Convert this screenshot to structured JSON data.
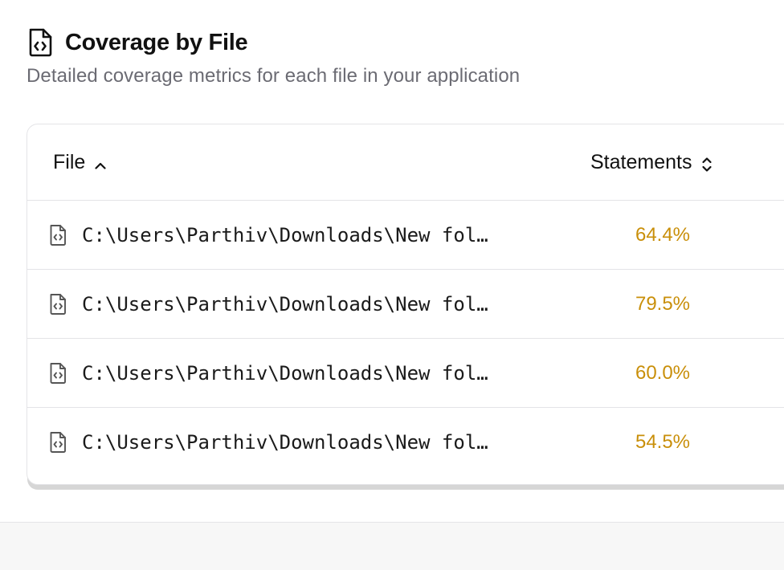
{
  "header": {
    "icon": "file-code-icon",
    "title": "Coverage by File",
    "subtitle": "Detailed coverage metrics for each file in your application"
  },
  "table": {
    "columns": {
      "file": {
        "label": "File",
        "sort_icon": "chevron-up-icon"
      },
      "statements": {
        "label": "Statements",
        "sort_icon": "chevrons-up-down-icon"
      }
    },
    "rows": [
      {
        "icon": "file-code-icon",
        "path": "C:\\Users\\Parthiv\\Downloads\\New fol…",
        "statements": "64.4%"
      },
      {
        "icon": "file-code-icon",
        "path": "C:\\Users\\Parthiv\\Downloads\\New fol…",
        "statements": "79.5%"
      },
      {
        "icon": "file-code-icon",
        "path": "C:\\Users\\Parthiv\\Downloads\\New fol…",
        "statements": "60.0%"
      },
      {
        "icon": "file-code-icon",
        "path": "C:\\Users\\Parthiv\\Downloads\\New fol…",
        "statements": "54.5%"
      }
    ]
  },
  "colors": {
    "accent_amber": "#c98f0a",
    "border": "#e4e4e7",
    "muted_text": "#6b6b73"
  }
}
